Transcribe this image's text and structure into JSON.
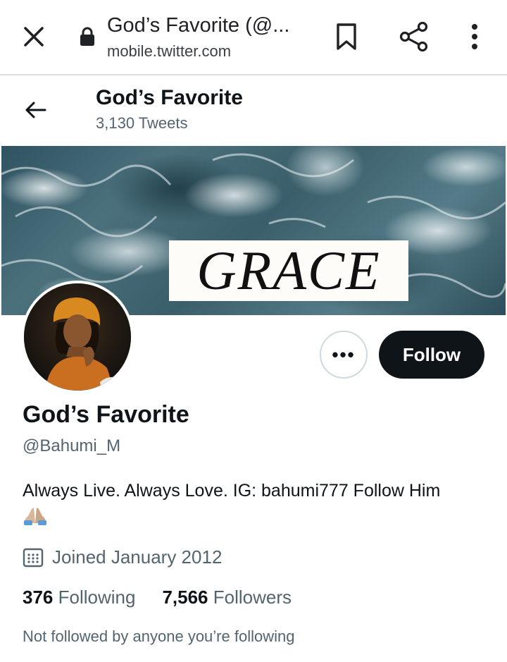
{
  "browser": {
    "title": "God’s Favorite (@...",
    "url": "mobile.twitter.com",
    "icons": [
      "close-icon",
      "lock-icon",
      "bookmark-icon",
      "share-icon",
      "more-vert-icon"
    ]
  },
  "header": {
    "name": "God’s Favorite",
    "tweet_count": "3,130 Tweets"
  },
  "banner": {
    "text": "GRACE"
  },
  "profile": {
    "more_label": "•••",
    "follow_label": "Follow",
    "display_name": "God’s Favorite",
    "handle": "@Bahumi_M",
    "bio": "Always Live. Always Love. IG: bahumi777 Follow Him",
    "bio_emoji": "🙏🏼",
    "joined": "Joined January 2012",
    "following_count": "376",
    "following_label": "Following",
    "followers_count": "7,566",
    "followers_label": "Followers",
    "not_followed": "Not followed by anyone you’re following"
  },
  "colors": {
    "text": "#0f1419",
    "secondary": "#536471",
    "follow_bg": "#0f1419",
    "border": "#cfd9de"
  }
}
